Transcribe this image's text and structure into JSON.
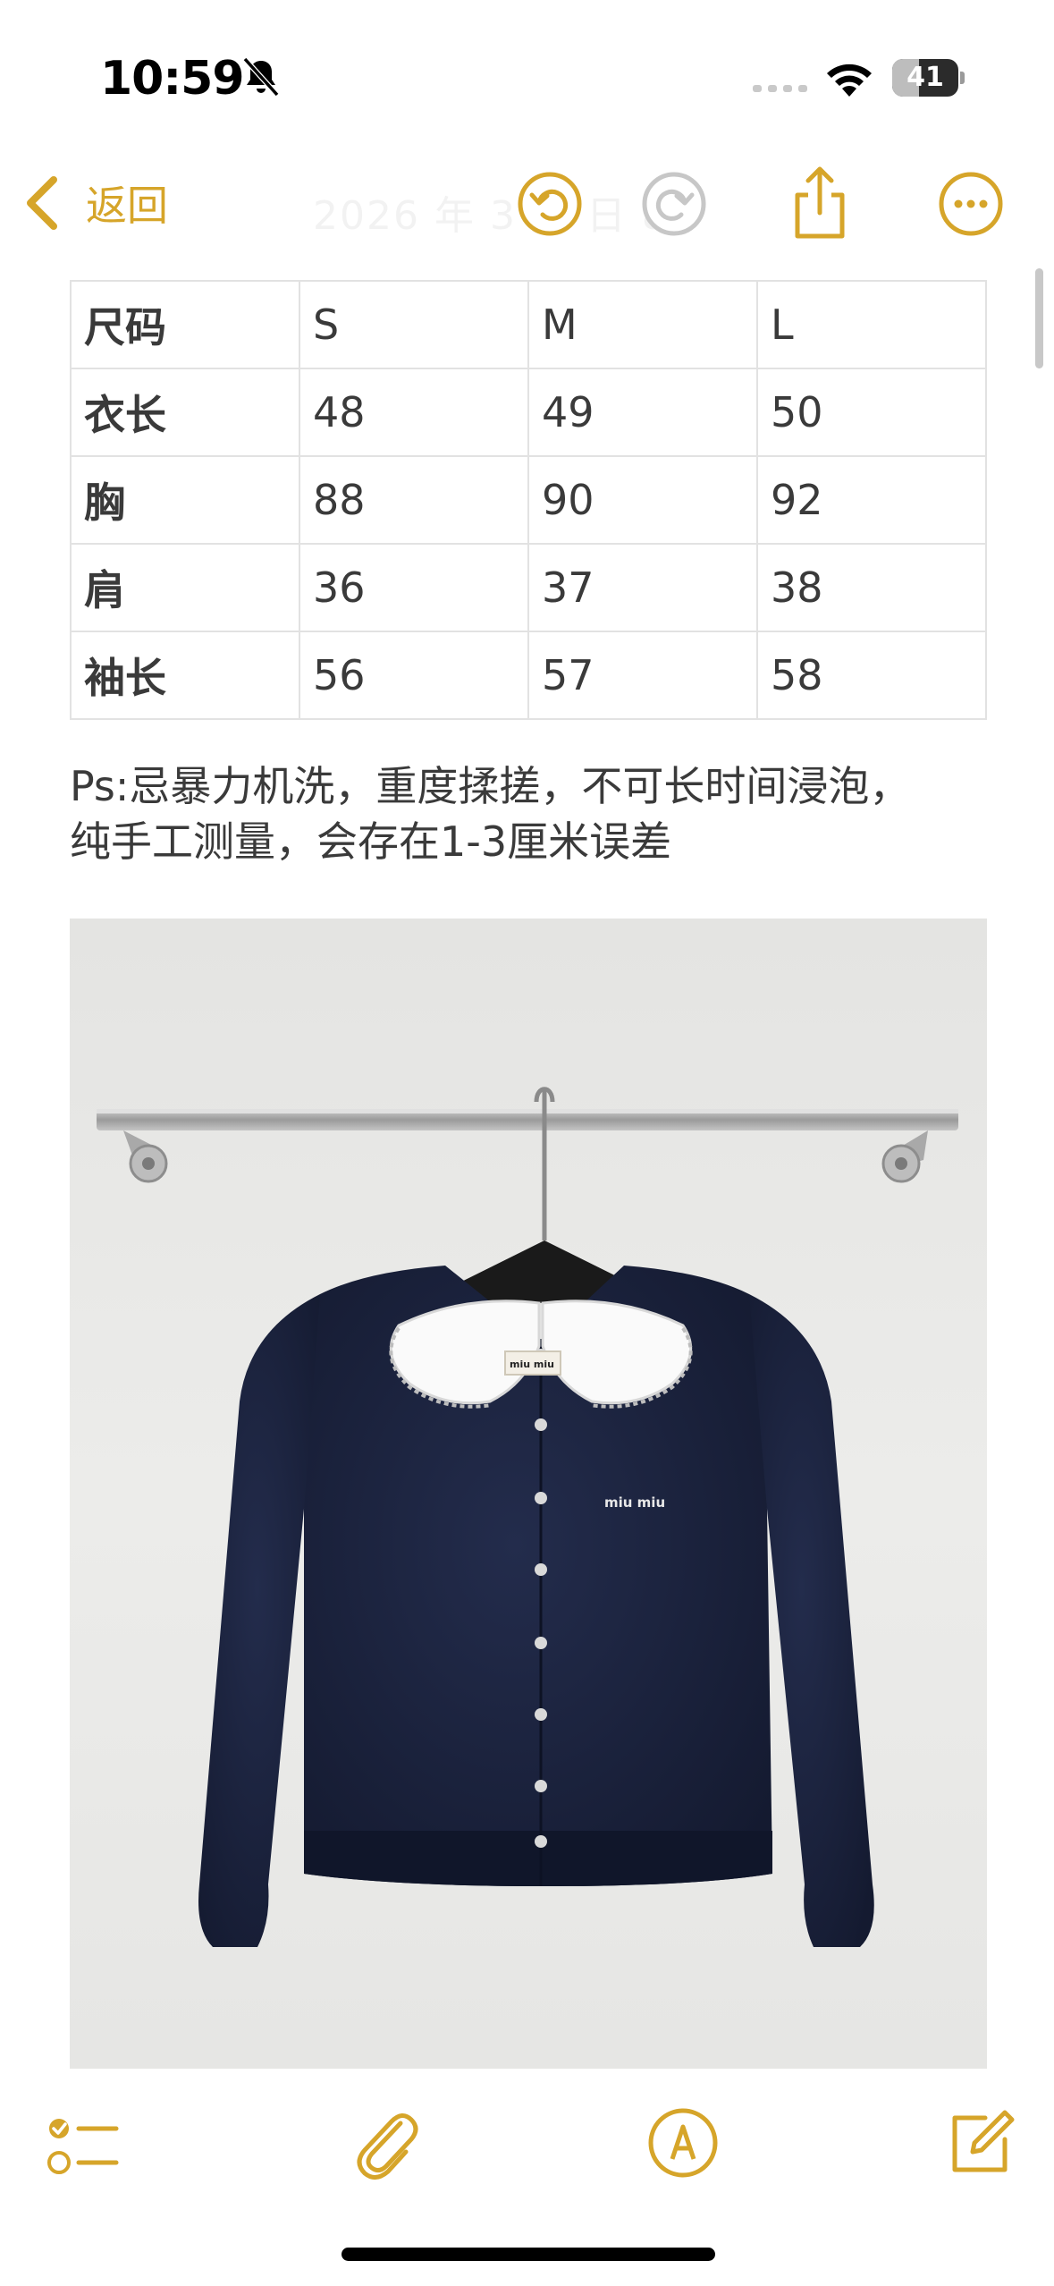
{
  "status_bar": {
    "time": "10:59",
    "battery_level": "41",
    "battery_fraction": 0.41,
    "icons": [
      "bell-muted-icon",
      "cellular-signal-icon",
      "wifi-icon",
      "battery-icon"
    ]
  },
  "nav": {
    "back_label": "返回",
    "faded_date": "2026 年 3 月  日     8",
    "icons": [
      "chevron-left-icon",
      "undo-icon",
      "redo-icon",
      "share-icon",
      "more-icon"
    ]
  },
  "size_table": {
    "rows": [
      [
        "尺码",
        "S",
        "M",
        "L"
      ],
      [
        "衣长",
        "48",
        "49",
        "50"
      ],
      [
        "胸",
        "88",
        "90",
        "92"
      ],
      [
        "肩",
        "36",
        "37",
        "38"
      ],
      [
        "袖长",
        "56",
        "57",
        "58"
      ]
    ]
  },
  "note": {
    "line1": "Ps:忌暴力机洗，重度揉搓，不可长时间浸泡，",
    "line2": "纯手工测量，会存在1-3厘米误差"
  },
  "photo": {
    "label_text": "miu miu",
    "embroidery_text": "miu miu"
  },
  "toolbar": {
    "icons": [
      "checklist-icon",
      "paperclip-icon",
      "markup-pen-icon",
      "compose-icon"
    ]
  },
  "colors": {
    "accent": "#d6a52a",
    "text": "#3a3a3a",
    "table_border": "#e2e2e2",
    "cardigan": "#1b2440"
  }
}
